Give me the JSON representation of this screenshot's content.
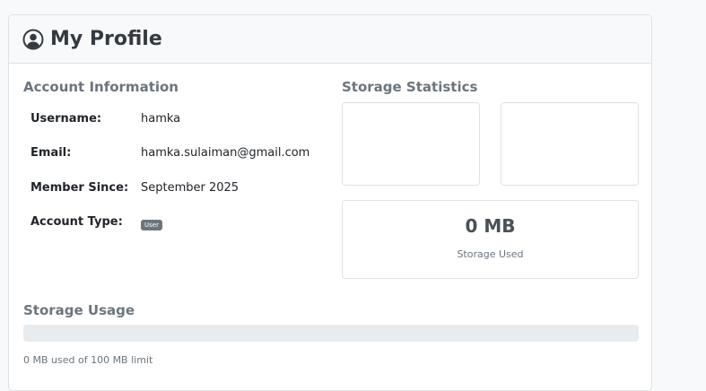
{
  "header": {
    "title": "My Profile",
    "icon": "user-circle-icon"
  },
  "account": {
    "section_title": "Account Information",
    "username_label": "Username:",
    "username_value": "hamka",
    "email_label": "Email:",
    "email_value": "hamka.sulaiman@gmail.com",
    "member_since_label": "Member Since:",
    "member_since_value": "September 2025",
    "account_type_label": "Account Type:",
    "account_type_badge": "User"
  },
  "storage_stats": {
    "section_title": "Storage Statistics",
    "used_value": "0 MB",
    "used_label": "Storage Used"
  },
  "storage_usage": {
    "section_title": "Storage Usage",
    "progress_fraction": 0,
    "summary": "0 MB used of 100 MB limit"
  },
  "colors": {
    "accent": "#0d6efd",
    "muted": "#6c757d",
    "border": "#dee2e6"
  }
}
